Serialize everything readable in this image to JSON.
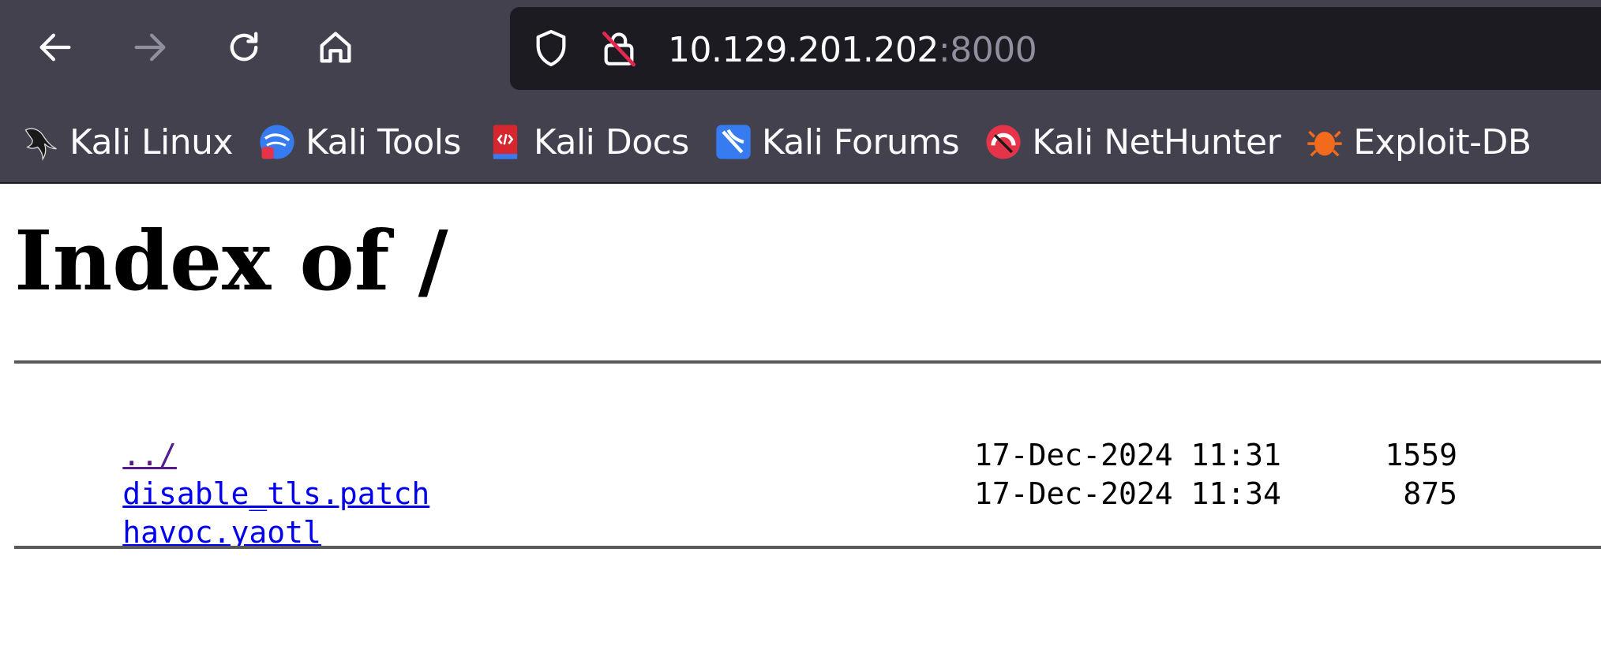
{
  "browser": {
    "nav": {
      "back_icon": "arrow-left-icon",
      "forward_icon": "arrow-right-icon",
      "reload_icon": "reload-icon",
      "home_icon": "home-icon"
    },
    "url": {
      "host": "10.129.201.202",
      "port": ":8000"
    },
    "bookmarks": [
      {
        "label": "Kali Linux",
        "icon": "kali-dragon-icon"
      },
      {
        "label": "Kali Tools",
        "icon": "kali-tools-icon"
      },
      {
        "label": "Kali Docs",
        "icon": "kali-docs-icon"
      },
      {
        "label": "Kali Forums",
        "icon": "kali-forums-icon"
      },
      {
        "label": "Kali NetHunter",
        "icon": "kali-nethunter-icon"
      },
      {
        "label": "Exploit-DB",
        "icon": "exploit-db-icon"
      }
    ],
    "colors": {
      "toolbar": "#42414d",
      "urlbar": "#1c1b22",
      "text": "#fbfbfe"
    }
  },
  "page": {
    "title": "Index of /",
    "entries": [
      {
        "name": "../",
        "date": "",
        "size": ""
      },
      {
        "name": "disable_tls.patch",
        "date": "17-Dec-2024 11:31",
        "size": "1559"
      },
      {
        "name": "havoc.yaotl",
        "date": "17-Dec-2024 11:34",
        "size": "875"
      }
    ]
  }
}
